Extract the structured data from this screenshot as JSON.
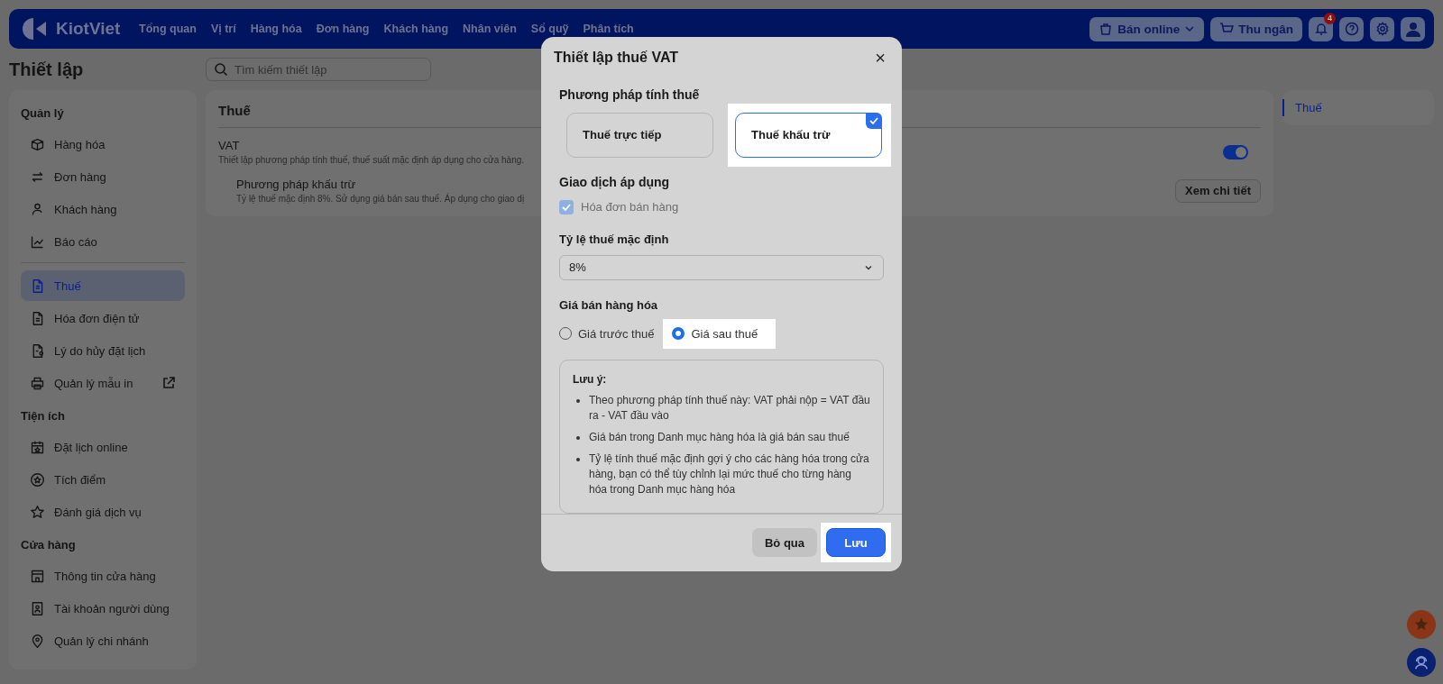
{
  "nav": {
    "logo": "KiotViet",
    "items": [
      "Tổng quan",
      "Vị trí",
      "Hàng hóa",
      "Đơn hàng",
      "Khách hàng",
      "Nhân viên",
      "Sổ quỹ",
      "Phân tích"
    ],
    "online_button": "Bán online",
    "cashier_button": "Thu ngân",
    "notification_count": "4"
  },
  "page_title": "Thiết lập",
  "search": {
    "placeholder": "Tìm kiếm thiết lập"
  },
  "sidebar": {
    "sections": [
      {
        "title": "Quản lý",
        "items": [
          {
            "label": "Hàng hóa",
            "selected": false
          },
          {
            "label": "Đơn hàng",
            "selected": false
          },
          {
            "label": "Khách hàng",
            "selected": false
          },
          {
            "label": "Báo cáo",
            "selected": false
          }
        ]
      },
      {
        "items": [
          {
            "label": "Thuế",
            "selected": true
          },
          {
            "label": "Hóa đơn điện tử",
            "selected": false
          },
          {
            "label": "Lý do hủy đặt lịch",
            "selected": false
          },
          {
            "label": "Quản lý mẫu in",
            "selected": false,
            "external": true
          }
        ]
      },
      {
        "title": "Tiện ích",
        "items": [
          {
            "label": "Đặt lịch online",
            "selected": false
          },
          {
            "label": "Tích điểm",
            "selected": false
          },
          {
            "label": "Đánh giá dịch vụ",
            "selected": false
          }
        ]
      },
      {
        "title": "Cửa hàng",
        "items": [
          {
            "label": "Thông tin cửa hàng",
            "selected": false
          },
          {
            "label": "Tài khoản người dùng",
            "selected": false
          },
          {
            "label": "Quản lý chi nhánh",
            "selected": false
          }
        ]
      }
    ]
  },
  "content": {
    "title": "Thuế",
    "vat": {
      "name": "VAT",
      "description": "Thiết lập phương pháp tính thuế, thuế suất mặc định áp dụng cho cửa hàng.",
      "on": true
    },
    "method": {
      "name": "Phương pháp khấu trừ",
      "description": "Tỷ lệ thuế mặc định 8%. Sử dụng giá bán sau thuế. Áp dụng cho giao dị",
      "button": "Xem chi tiết"
    }
  },
  "toc": {
    "items": [
      {
        "label": "Thuế",
        "selected": true
      }
    ]
  },
  "modal": {
    "title": "Thiết lập thuế VAT",
    "close": "×",
    "method_label": "Phương pháp tính thuế",
    "methods": [
      {
        "label": "Thuế trực tiếp",
        "selected": false
      },
      {
        "label": "Thuế khấu trừ",
        "selected": true
      }
    ],
    "transactions_label": "Giao dịch áp dụng",
    "transactions": [
      {
        "label": "Hóa đơn bán hàng",
        "checked": true,
        "disabled": true
      }
    ],
    "rate_label": "Tỷ lệ thuế mặc định",
    "rate": {
      "value": "8%"
    },
    "price_label": "Giá bán hàng hóa",
    "prices": [
      {
        "label": "Giá trước thuế",
        "selected": false
      },
      {
        "label": "Giá sau thuế",
        "selected": true
      }
    ],
    "note": {
      "title": "Lưu ý:",
      "items": [
        "Theo phương pháp tính thuế này: VAT phải nộp = VAT đầu ra - VAT đầu vào",
        "Giá bán trong Danh mục hàng hóa là giá bán sau thuế",
        "Tỷ lệ tính thuế mặc định gợi ý cho các hàng hóa trong cửa hàng, bạn có thể tùy chỉnh lại mức thuế cho từng hàng hóa trong Danh mục hàng hóa"
      ]
    },
    "cancel_button": "Bỏ qua",
    "save_button": "Lưu"
  }
}
